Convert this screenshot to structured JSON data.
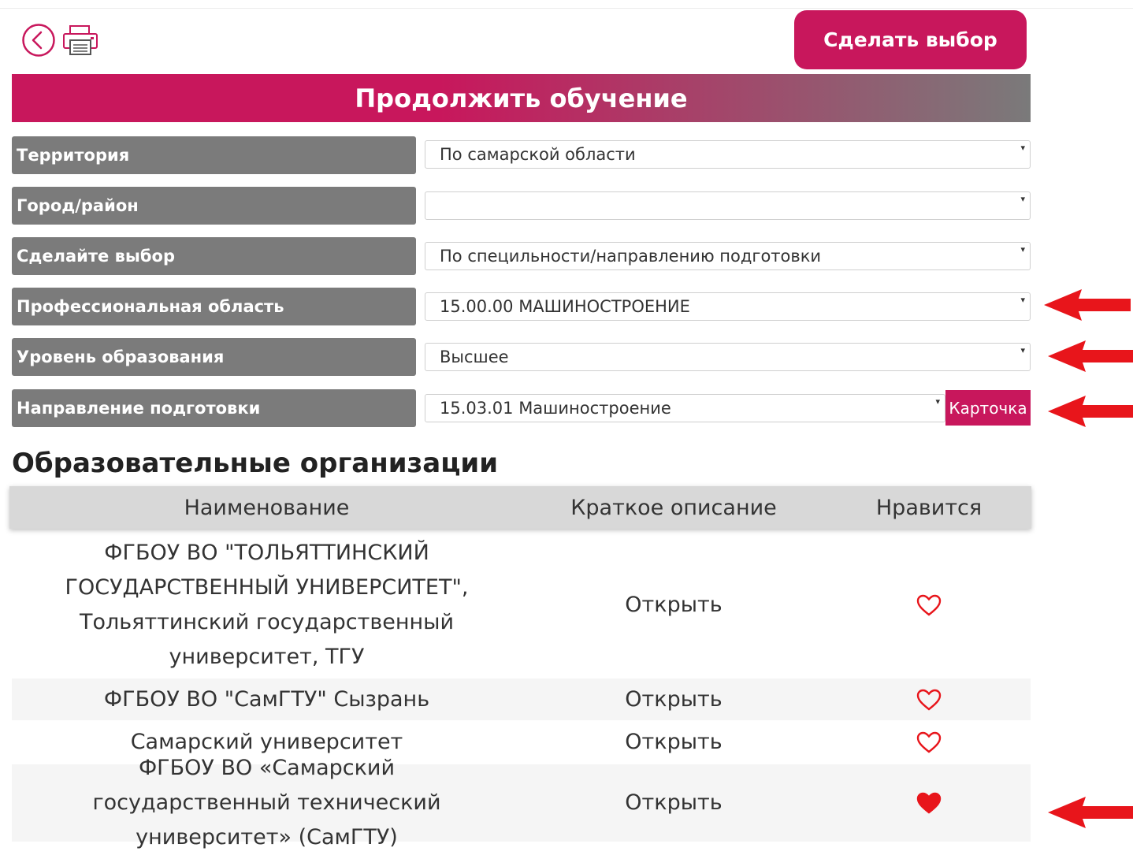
{
  "header": {
    "make_choice_label": "Сделать выбор",
    "banner_title": "Продолжить обучение"
  },
  "filters": [
    {
      "label": "Территория",
      "value": "По самарской области"
    },
    {
      "label": "Город/район",
      "value": ""
    },
    {
      "label": "Сделайте выбор",
      "value": "По специльности/направлению подготовки"
    },
    {
      "label": "Профессиональная область",
      "value": "15.00.00 МАШИНОСТРОЕНИЕ"
    },
    {
      "label": "Уровень образования",
      "value": "Высшее"
    },
    {
      "label": "Направление подготовки",
      "value": "15.03.01 Машиностроение"
    }
  ],
  "card_button_label": "Карточка",
  "section_title": "Образовательные организации",
  "table": {
    "headers": [
      "Наименование",
      "Краткое описание",
      "Нравится"
    ],
    "rows": [
      {
        "name": "ФГБОУ ВО \"ТОЛЬЯТТИНСКИЙ ГОСУДАРСТВЕННЫЙ УНИВЕРСИТЕТ\", Тольяттинский государственный университет, ТГУ",
        "open": "Открыть",
        "liked": false
      },
      {
        "name": "ФГБОУ ВО \"СамГТУ\" Сызрань",
        "open": "Открыть",
        "liked": false
      },
      {
        "name": "Самарский университет",
        "open": "Открыть",
        "liked": false
      },
      {
        "name": "ФГБОУ ВО «Самарский государственный технический университет» (СамГТУ)",
        "open": "Открыть",
        "liked": true
      }
    ]
  },
  "colors": {
    "accent": "#c8175c",
    "label_bg": "#7b7b7b",
    "annotation_arrow": "#e8151b"
  }
}
